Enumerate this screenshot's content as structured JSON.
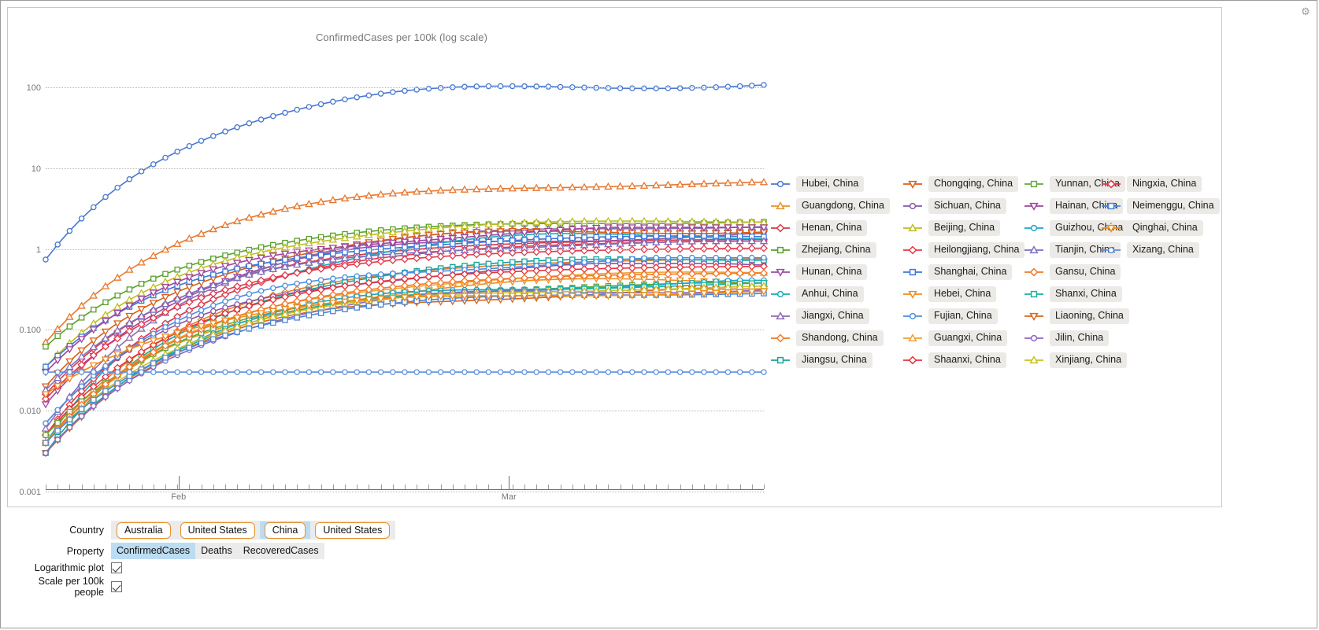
{
  "window": {
    "gear_icon": "gear-icon"
  },
  "chart": {
    "title": "ConfirmedCases per 100k (log scale)",
    "y_ticks": [
      "100",
      "10",
      "1",
      "0.100",
      "0.010",
      "0.001"
    ],
    "x_ticks": [
      "Feb",
      "Mar"
    ]
  },
  "chart_data": {
    "type": "line",
    "title": "ConfirmedCases per 100k (log scale)",
    "xlabel": "",
    "ylabel": "",
    "yscale": "log",
    "ylim": [
      0.001,
      200
    ],
    "ytick_values": [
      100,
      10,
      1,
      0.1,
      0.01,
      0.001
    ],
    "ytick_labels": [
      "100",
      "10",
      "1",
      "0.100",
      "0.010",
      "0.001"
    ],
    "xtick_labels": [
      "Feb",
      "Mar"
    ],
    "grid": "horizontal-dotted",
    "legend_position": "right",
    "x_start": "2020-01-22",
    "x_end": "2020-03-22",
    "series": [
      {
        "name": "Hubei, China",
        "color": "#4878cf",
        "marker": "circle",
        "start": 0.74,
        "end": 115.0,
        "rise": 0.92
      },
      {
        "name": "Guangdong, China",
        "color": "#e8762c",
        "marker": "triangle-up",
        "start": 0.07,
        "end": 6.7,
        "rise": 0.9
      },
      {
        "name": "Henan, China",
        "color": "#d73a49",
        "marker": "diamond",
        "start": 0.016,
        "end": 1.35,
        "rise": 0.88
      },
      {
        "name": "Zhejiang, China",
        "color": "#5aa02c",
        "marker": "square",
        "start": 0.062,
        "end": 2.25,
        "rise": 0.9
      },
      {
        "name": "Hunan, China",
        "color": "#9a4ea3",
        "marker": "triangle-down",
        "start": 0.012,
        "end": 1.55,
        "rise": 0.87
      },
      {
        "name": "Anhui, China",
        "color": "#19a9b5",
        "marker": "circle",
        "start": 0.004,
        "end": 1.6,
        "rise": 0.86
      },
      {
        "name": "Jiangxi, China",
        "color": "#8c6bb1",
        "marker": "triangle-up",
        "start": 0.006,
        "end": 2.05,
        "rise": 0.86
      },
      {
        "name": "Shandong, China",
        "color": "#f07c25",
        "marker": "diamond",
        "start": 0.004,
        "end": 0.78,
        "rise": 0.85
      },
      {
        "name": "Jiangsu, China",
        "color": "#17a398",
        "marker": "square",
        "start": 0.003,
        "end": 0.8,
        "rise": 0.85
      },
      {
        "name": "Chongqing, China",
        "color": "#d95f15",
        "marker": "triangle-down",
        "start": 0.02,
        "end": 1.8,
        "rise": 0.88
      },
      {
        "name": "Sichuan, China",
        "color": "#8856a7",
        "marker": "circle",
        "start": 0.007,
        "end": 0.66,
        "rise": 0.86
      },
      {
        "name": "Beijing, China",
        "color": "#bdbd22",
        "marker": "triangle-up",
        "start": 0.035,
        "end": 2.3,
        "rise": 0.88
      },
      {
        "name": "Heilongjiang, China",
        "color": "#e8394a",
        "marker": "diamond",
        "start": 0.005,
        "end": 1.3,
        "rise": 0.86
      },
      {
        "name": "Shanghai, China",
        "color": "#3b78d8",
        "marker": "square",
        "start": 0.035,
        "end": 1.45,
        "rise": 0.88
      },
      {
        "name": "Hebei, China",
        "color": "#f08c20",
        "marker": "triangle-down",
        "start": 0.004,
        "end": 0.43,
        "rise": 0.85
      },
      {
        "name": "Fujian, China",
        "color": "#4a8fe0",
        "marker": "circle",
        "start": 0.007,
        "end": 0.78,
        "rise": 0.86
      },
      {
        "name": "Guangxi, China",
        "color": "#f0a030",
        "marker": "triangle-up",
        "start": 0.004,
        "end": 0.52,
        "rise": 0.85
      },
      {
        "name": "Shaanxi, China",
        "color": "#e8333a",
        "marker": "diamond",
        "start": 0.005,
        "end": 0.63,
        "rise": 0.85
      },
      {
        "name": "Yunnan, China",
        "color": "#63a83a",
        "marker": "square",
        "start": 0.005,
        "end": 0.38,
        "rise": 0.85
      },
      {
        "name": "Hainan, China",
        "color": "#a1449c",
        "marker": "triangle-down",
        "start": 0.03,
        "end": 1.85,
        "rise": 0.87
      },
      {
        "name": "Guizhou, China",
        "color": "#1aa5c8",
        "marker": "circle",
        "start": 0.003,
        "end": 0.41,
        "rise": 0.85
      },
      {
        "name": "Tianjin, China",
        "color": "#7b6fc0",
        "marker": "triangle-up",
        "start": 0.018,
        "end": 1.25,
        "rise": 0.87
      },
      {
        "name": "Gansu, China",
        "color": "#f2762a",
        "marker": "diamond",
        "start": 0.004,
        "end": 0.52,
        "rise": 0.85
      },
      {
        "name": "Shanxi, China",
        "color": "#17b0a0",
        "marker": "square",
        "start": 0.003,
        "end": 0.38,
        "rise": 0.85
      },
      {
        "name": "Liaoning, China",
        "color": "#d9651a",
        "marker": "triangle-down",
        "start": 0.003,
        "end": 0.32,
        "rise": 0.85
      },
      {
        "name": "Jilin, China",
        "color": "#8e63c4",
        "marker": "circle",
        "start": 0.003,
        "end": 0.34,
        "rise": 0.85
      },
      {
        "name": "Xinjiang, China",
        "color": "#c9c125",
        "marker": "triangle-up",
        "start": 0.004,
        "end": 0.35,
        "rise": 0.85
      },
      {
        "name": "Ningxia, China",
        "color": "#e0384c",
        "marker": "diamond",
        "start": 0.014,
        "end": 1.05,
        "rise": 0.86
      },
      {
        "name": "Neimenggu, China",
        "color": "#4a86d8",
        "marker": "square",
        "start": 0.004,
        "end": 0.3,
        "rise": 0.85
      },
      {
        "name": "Qinghai, China",
        "color": "#ef8a1e",
        "marker": "triangle-down",
        "start": 0.016,
        "end": 0.3,
        "rise": 0.86
      },
      {
        "name": "Xizang, China",
        "color": "#5b8fdc",
        "marker": "circle",
        "start": 0.03,
        "end": 0.03,
        "rise": 0.99
      }
    ]
  },
  "legend": {
    "columns": [
      [
        {
          "label": "Hubei, China",
          "color": "#4878cf",
          "marker": "circle"
        },
        {
          "label": "Guangdong, China",
          "color": "#e8902a",
          "marker": "triangle-up"
        },
        {
          "label": "Henan, China",
          "color": "#d73a49",
          "marker": "diamond"
        },
        {
          "label": "Zhejiang, China",
          "color": "#5aa02c",
          "marker": "square"
        },
        {
          "label": "Hunan, China",
          "color": "#9a4ea3",
          "marker": "triangle-down"
        },
        {
          "label": "Anhui, China",
          "color": "#19a9b5",
          "marker": "circle"
        },
        {
          "label": "Jiangxi, China",
          "color": "#8c6bb1",
          "marker": "triangle-up"
        },
        {
          "label": "Shandong, China",
          "color": "#f07c25",
          "marker": "diamond"
        },
        {
          "label": "Jiangsu, China",
          "color": "#17a398",
          "marker": "square"
        }
      ],
      [
        {
          "label": "Chongqing, China",
          "color": "#d95f15",
          "marker": "triangle-down"
        },
        {
          "label": "Sichuan, China",
          "color": "#8856a7",
          "marker": "circle"
        },
        {
          "label": "Beijing, China",
          "color": "#bdbd22",
          "marker": "triangle-up"
        },
        {
          "label": "Heilongjiang, China",
          "color": "#e8394a",
          "marker": "diamond"
        },
        {
          "label": "Shanghai, China",
          "color": "#3b78d8",
          "marker": "square"
        },
        {
          "label": "Hebei, China",
          "color": "#f08c20",
          "marker": "triangle-down"
        },
        {
          "label": "Fujian, China",
          "color": "#4a8fe0",
          "marker": "circle"
        },
        {
          "label": "Guangxi, China",
          "color": "#f0a030",
          "marker": "triangle-up"
        },
        {
          "label": "Shaanxi, China",
          "color": "#e8333a",
          "marker": "diamond"
        }
      ],
      [
        {
          "label": "Yunnan, China",
          "color": "#63a83a",
          "marker": "square"
        },
        {
          "label": "Hainan, China",
          "color": "#a1449c",
          "marker": "triangle-down"
        },
        {
          "label": "Guizhou, China",
          "color": "#1aa5c8",
          "marker": "circle"
        },
        {
          "label": "Tianjin, China",
          "color": "#7b6fc0",
          "marker": "triangle-up"
        },
        {
          "label": "Gansu, China",
          "color": "#f2762a",
          "marker": "diamond"
        },
        {
          "label": "Shanxi, China",
          "color": "#17b0a0",
          "marker": "square"
        },
        {
          "label": "Liaoning, China",
          "color": "#d9651a",
          "marker": "triangle-down"
        },
        {
          "label": "Jilin, China",
          "color": "#8e63c4",
          "marker": "circle"
        },
        {
          "label": "Xinjiang, China",
          "color": "#c9c125",
          "marker": "triangle-up"
        }
      ],
      [
        {
          "label": "Ningxia, China",
          "color": "#e0384c",
          "marker": "diamond"
        },
        {
          "label": "Neimenggu, China",
          "color": "#4a86d8",
          "marker": "square"
        },
        {
          "label": "Qinghai, China",
          "color": "#ef8a1e",
          "marker": "triangle-down"
        },
        {
          "label": "Xizang, China",
          "color": "#5b8fdc",
          "marker": "circle"
        }
      ]
    ]
  },
  "controls": {
    "country": {
      "label": "Country",
      "options": [
        "Australia",
        "United States",
        "China",
        "United States"
      ],
      "selected_index": 2
    },
    "property": {
      "label": "Property",
      "options": [
        "ConfirmedCases",
        "Deaths",
        "RecoveredCases"
      ],
      "selected_index": 0
    },
    "logarithmic": {
      "label": "Logarithmic plot",
      "checked": true
    },
    "scale100k": {
      "label": "Scale per 100k people",
      "checked": true
    }
  }
}
